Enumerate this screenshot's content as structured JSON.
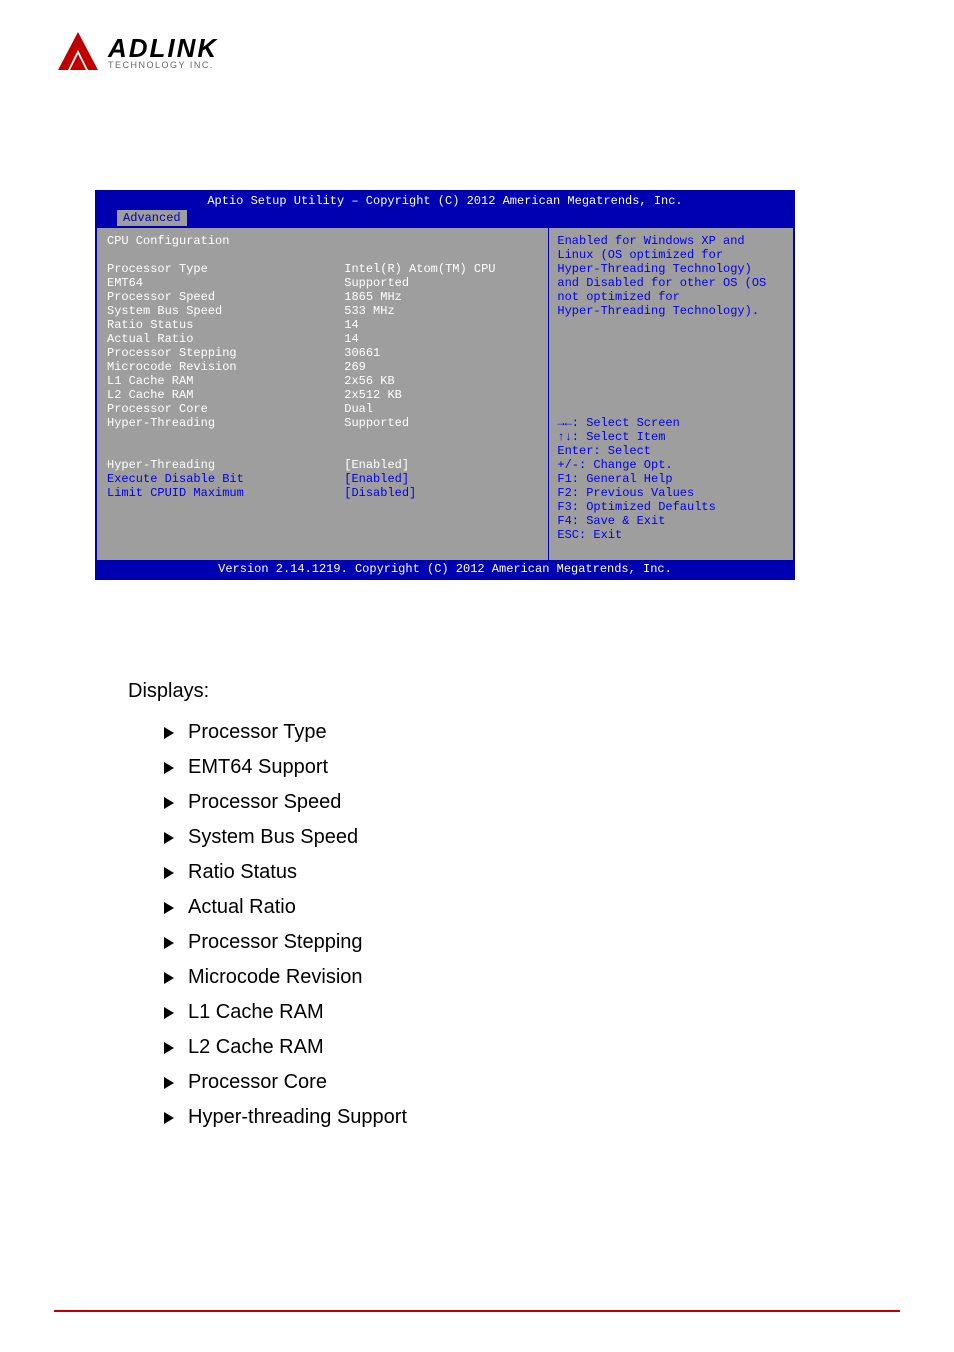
{
  "logo": {
    "brand": "ADLINK",
    "tag": "TECHNOLOGY INC."
  },
  "bios": {
    "header": "Aptio Setup Utility – Copyright (C) 2012 American Megatrends, Inc.",
    "tab": "Advanced",
    "section_title": "CPU Configuration",
    "info": [
      {
        "label": "Processor Type",
        "value": "Intel(R) Atom(TM) CPU"
      },
      {
        "label": "EMT64",
        "value": "Supported"
      },
      {
        "label": "Processor Speed",
        "value": "1865 MHz"
      },
      {
        "label": "System Bus Speed",
        "value": "533 MHz"
      },
      {
        "label": "Ratio Status",
        "value": "14"
      },
      {
        "label": "Actual Ratio",
        "value": "14"
      },
      {
        "label": "Processor Stepping",
        "value": "30661"
      },
      {
        "label": "Microcode Revision",
        "value": "269"
      },
      {
        "label": "L1 Cache RAM",
        "value": "2x56 KB"
      },
      {
        "label": "L2 Cache RAM",
        "value": "2x512 KB"
      },
      {
        "label": "Processor Core",
        "value": "Dual"
      },
      {
        "label": "Hyper-Threading",
        "value": "Supported"
      }
    ],
    "configs": [
      {
        "label": "Hyper-Threading",
        "value": "[Enabled]",
        "selected": true
      },
      {
        "label": "Execute Disable Bit",
        "value": "[Enabled]",
        "selected": false
      },
      {
        "label": "Limit CPUID Maximum",
        "value": "[Disabled]",
        "selected": false
      }
    ],
    "help": {
      "lines": [
        "Enabled for Windows XP and",
        "Linux (OS optimized for",
        "Hyper-Threading Technology)",
        "and Disabled for other OS (OS",
        "not optimized for",
        "Hyper-Threading Technology)."
      ],
      "keys": [
        "→←: Select Screen",
        "↑↓: Select Item",
        "Enter: Select",
        "+/-: Change Opt.",
        "F1: General Help",
        "F2: Previous Values",
        "F3: Optimized Defaults",
        "F4: Save & Exit",
        "ESC: Exit"
      ]
    },
    "footer": "Version 2.14.1219. Copyright (C) 2012 American Megatrends, Inc."
  },
  "doc": {
    "heading": "Displays:",
    "items": [
      "Processor Type",
      "EMT64 Support",
      "Processor Speed",
      "System Bus Speed",
      "Ratio Status",
      "Actual Ratio",
      "Processor Stepping",
      "Microcode Revision",
      "L1 Cache RAM",
      "L2 Cache RAM",
      "Processor Core",
      "Hyper-threading Support"
    ]
  }
}
